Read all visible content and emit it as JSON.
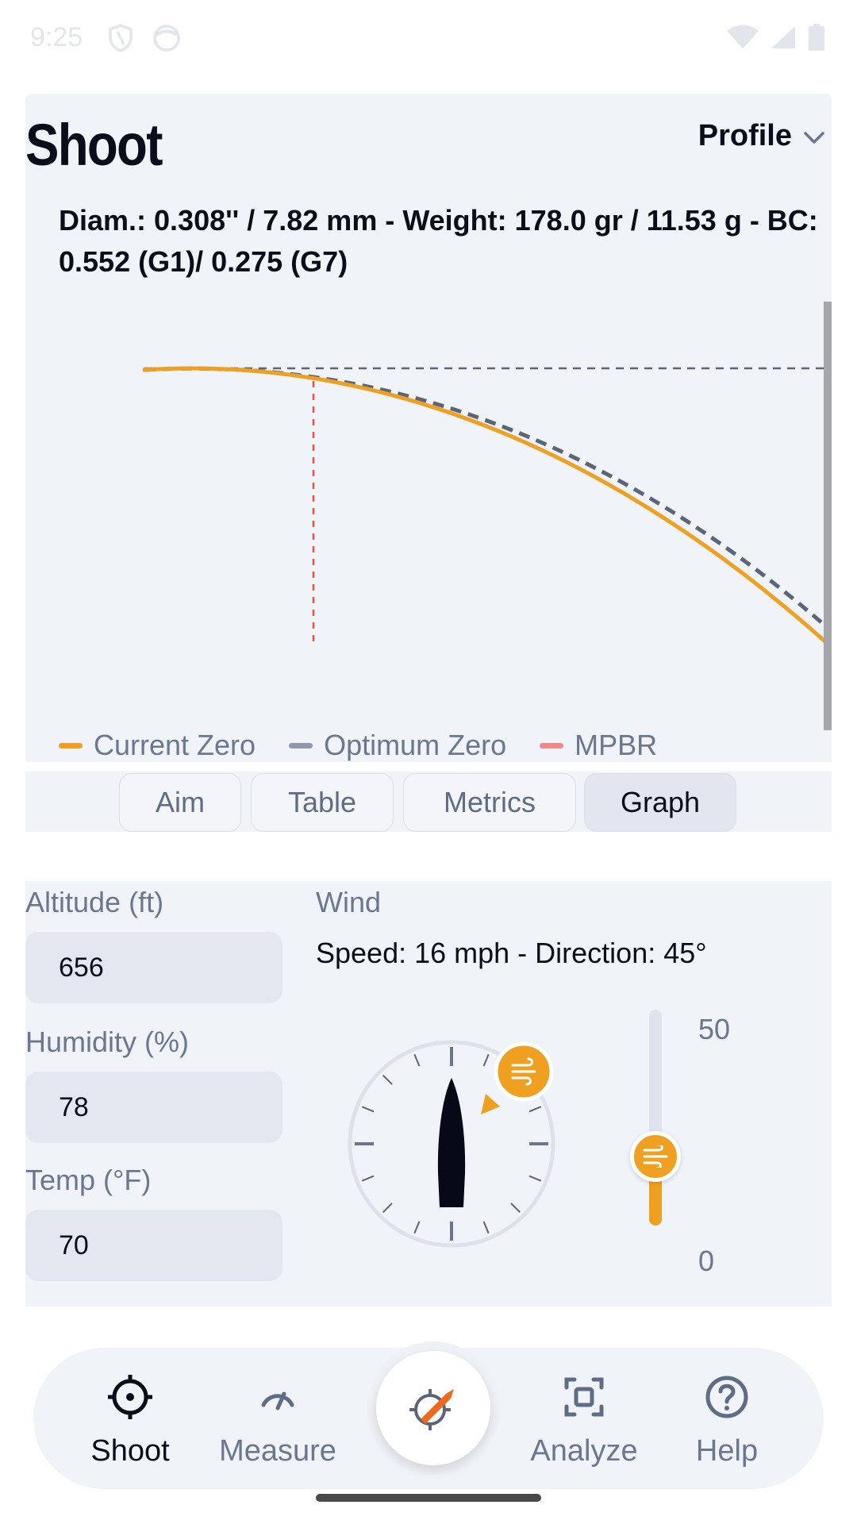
{
  "status_bar": {
    "time": "9:25"
  },
  "header": {
    "title": "Shoot",
    "profile_label": "Profile",
    "profile_info": "Diam.: 0.308'' / 7.82 mm - Weight: 178.0 gr / 11.53 g - BC: 0.552 (G1)/ 0.275 (G7)"
  },
  "graph": {
    "legend": [
      {
        "label": "Current Zero",
        "color": "#f0a020"
      },
      {
        "label": "Optimum Zero",
        "color": "#8e99ad"
      },
      {
        "label": "MPBR",
        "color": "#f08a8a"
      }
    ]
  },
  "tabs": [
    {
      "label": "Aim",
      "active": false
    },
    {
      "label": "Table",
      "active": false
    },
    {
      "label": "Metrics",
      "active": false
    },
    {
      "label": "Graph",
      "active": true
    }
  ],
  "conditions": {
    "altitude": {
      "label": "Altitude (ft)",
      "value": "656"
    },
    "humidity": {
      "label": "Humidity (%)",
      "value": "78"
    },
    "temp": {
      "label": "Temp (°F)",
      "value": "70"
    }
  },
  "wind": {
    "label": "Wind",
    "value_text": "Speed: 16 mph - Direction: 45°",
    "direction_deg": 45,
    "speed": 16,
    "slider_max": "50",
    "slider_min": "0",
    "accent": "#f0a020"
  },
  "nav": {
    "items": [
      {
        "label": "Shoot",
        "icon": "crosshair-icon",
        "active": true
      },
      {
        "label": "Measure",
        "icon": "gauge-icon",
        "active": false
      },
      {
        "label": "Analyze",
        "icon": "scan-icon",
        "active": false
      },
      {
        "label": "Help",
        "icon": "help-circle-icon",
        "active": false
      }
    ],
    "fab_icon": "bullet-target-icon"
  }
}
